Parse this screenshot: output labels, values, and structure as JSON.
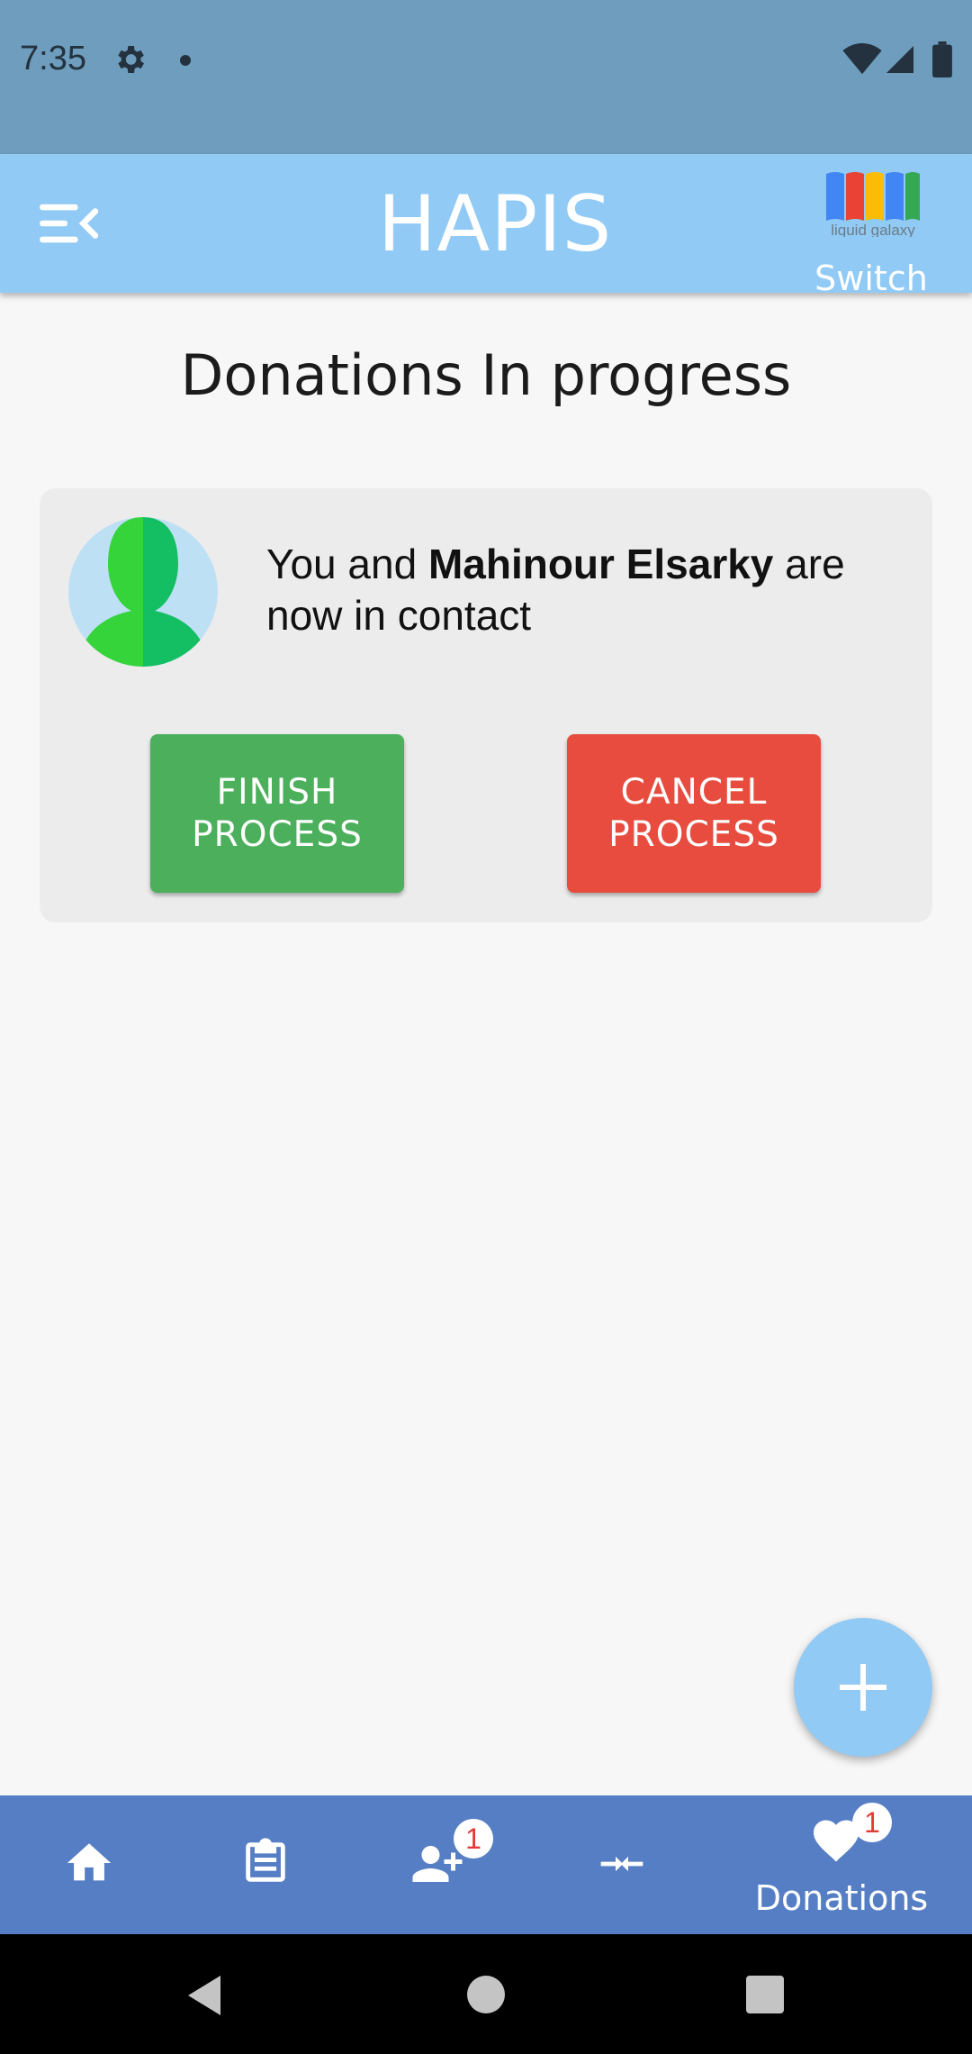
{
  "status_bar": {
    "time": "7:35",
    "icons": [
      "gear-icon",
      "notification-dot",
      "wifi-icon",
      "signal-icon",
      "battery-icon"
    ]
  },
  "app_bar": {
    "title": "HAPIS",
    "menu_icon": "menu-collapse-icon",
    "switch_label": "Switch",
    "logo_text": "liquid galaxy"
  },
  "page": {
    "title": "Donations In progress"
  },
  "donation_card": {
    "text_prefix": "You and ",
    "contact_name": "Mahinour Elsarky",
    "text_suffix": " are now in contact",
    "finish_label": "FINISH PROCESS",
    "cancel_label": "CANCEL PROCESS"
  },
  "fab": {
    "icon": "plus-icon"
  },
  "bottom_nav": {
    "items": [
      {
        "icon": "home-icon"
      },
      {
        "icon": "clipboard-icon"
      },
      {
        "icon": "add-user-icon",
        "badge": "1"
      },
      {
        "icon": "compare-arrows-icon"
      },
      {
        "icon": "heart-icon",
        "badge": "1",
        "label": "Donations"
      }
    ]
  },
  "colors": {
    "status_bar": "#6e9dbd",
    "app_bar": "#90caf5",
    "bottom_nav": "#567ec4",
    "finish": "#4caf5c",
    "cancel": "#e74c3f"
  }
}
